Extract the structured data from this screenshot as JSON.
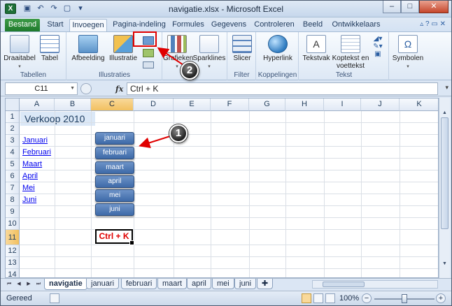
{
  "window": {
    "title": "navigatie.xlsx - Microsoft Excel",
    "app_icon": "X",
    "minimize": "–",
    "maximize": "□",
    "close": "✕"
  },
  "ribbon_tabs": [
    "Bestand",
    "Start",
    "Invoegen",
    "Pagina-indeling",
    "Formules",
    "Gegevens",
    "Controleren",
    "Beeld",
    "Ontwikkelaars"
  ],
  "active_tab": "Invoegen",
  "ribbon": {
    "groups": {
      "tabellen": "Tabellen",
      "illustraties": "Illustraties",
      "filter": "Filter",
      "koppelingen": "Koppelingen",
      "tekst": "Tekst"
    },
    "buttons": {
      "draaitabel": "Draaitabel",
      "tabel": "Tabel",
      "afbeelding": "Afbeelding",
      "illustratie": "Illustratie",
      "grafieken": "Grafieken",
      "sparklines": "Sparklines",
      "slicer": "Slicer",
      "hyperlink": "Hyperlink",
      "tekstvak": "Tekstvak",
      "koptekst_1": "Koptekst en",
      "koptekst_2": "voettekst",
      "symbolen": "Symbolen"
    }
  },
  "formula_bar": {
    "name_box": "C11",
    "fx": "fx",
    "content": "Ctrl + K"
  },
  "columns": [
    "A",
    "B",
    "C",
    "D",
    "E",
    "F",
    "G",
    "H",
    "I",
    "J",
    "K"
  ],
  "selected_column": "C",
  "rows": [
    "1",
    "2",
    "3",
    "4",
    "5",
    "6",
    "7",
    "8",
    "9",
    "10",
    "11",
    "12",
    "13",
    "14"
  ],
  "selected_row": "11",
  "cells": {
    "title": "Verkoop 2010",
    "links": [
      "Januari",
      "Februari",
      "Maart",
      "April",
      "Mei",
      "Juni"
    ],
    "buttons": [
      "januari",
      "februari",
      "maart",
      "april",
      "mei",
      "juni"
    ],
    "active_cell": "Ctrl + K"
  },
  "sheet_tabs": [
    "navigatie",
    "januari",
    "februari",
    "maart",
    "april",
    "mei",
    "juni"
  ],
  "active_sheet": "navigatie",
  "status": {
    "text": "Gereed",
    "zoom": "100%",
    "zoom_level": 0.5
  },
  "annotations": {
    "callout_1": "1",
    "callout_2": "2"
  },
  "colors": {
    "file_tab": "#1f7a2c",
    "nav_button": "#4f7bb8",
    "highlight_red": "#e00000",
    "selected_header": "#f5c96e"
  }
}
